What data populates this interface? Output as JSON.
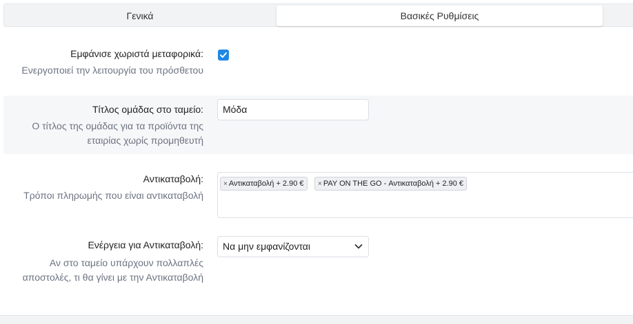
{
  "tabs": {
    "general": "Γενικά",
    "basic_settings": "Βασικές Ρυθμίσεις"
  },
  "show_carriers": {
    "label": "Εμφάνισε χωριστά μεταφορικά:",
    "description": "Ενεργοποιεί την λειτουργία του πρόσθετου",
    "checked": true
  },
  "group_title": {
    "label": "Τίτλος ομάδας στο ταμείο:",
    "description_line1": "Ο τίτλος της ομάδας για τα προϊόντα της",
    "description_line2": "εταιρίας χωρίς προμηθευτή",
    "value": "Μόδα"
  },
  "cod": {
    "label": "Αντικαταβολή:",
    "description": "Τρόποι πληρωμής που είναι αντικαταβολή",
    "chips": [
      "Αντικαταβολή + 2.90 €",
      "PAY ON THE GO - Αντικαταβολή + 2.90 €"
    ],
    "remove_symbol": "×"
  },
  "cod_action": {
    "label": "Ενέργεια για Αντικαταβολή:",
    "description_line1": "Αν στο ταμείο υπάρχουν πολλαπλές",
    "description_line2": "αποστολές, τι θα γίνει με την Αντικαταβολή",
    "selected": "Να μην εμφανίζονται"
  },
  "colors": {
    "accent": "#1e88e5"
  }
}
